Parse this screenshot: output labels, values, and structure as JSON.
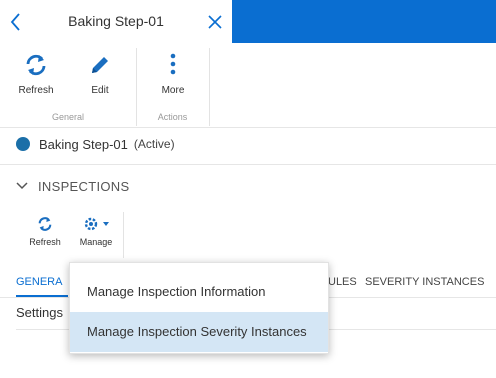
{
  "header": {
    "title": "Baking Step-01"
  },
  "toolbar": {
    "general": {
      "label": "General",
      "refresh": "Refresh",
      "edit": "Edit"
    },
    "actions": {
      "label": "Actions",
      "more": "More"
    }
  },
  "record": {
    "name": "Baking Step-01",
    "status": "(Active)",
    "status_color": "#1b6fa8"
  },
  "inspections": {
    "section_title": "INSPECTIONS",
    "refresh": "Refresh",
    "manage": "Manage"
  },
  "tabs": {
    "general": "GENERA",
    "rules": "ULES",
    "severity": "SEVERITY INSTANCES"
  },
  "content": {
    "settings": "Settings"
  },
  "manage_menu": {
    "items": [
      "Manage Inspection Information",
      "Manage Inspection Severity Instances"
    ]
  },
  "colors": {
    "accent": "#0a6ed1",
    "menu_hover": "#d4e6f5"
  }
}
